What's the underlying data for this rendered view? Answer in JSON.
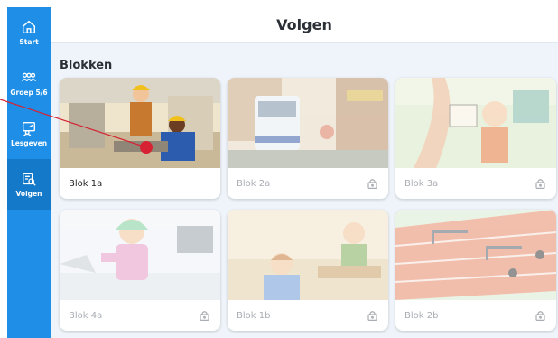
{
  "app": {
    "title": "Volgen"
  },
  "colors": {
    "sidebar": "#1e8ee6",
    "sidebar_active": "#1579c9",
    "background": "#eef4fa",
    "pointer": "#d62232"
  },
  "sidebar": {
    "items": [
      {
        "label": "Start",
        "icon": "home-icon"
      },
      {
        "label": "Groep 5/6",
        "icon": "group-icon"
      },
      {
        "label": "Lesgeven",
        "icon": "teach-icon"
      },
      {
        "label": "Volgen",
        "icon": "track-icon",
        "active": true
      }
    ]
  },
  "main": {
    "section_title": "Blokken",
    "cards": [
      {
        "label": "Blok 1a",
        "locked": false
      },
      {
        "label": "Blok 2a",
        "locked": true
      },
      {
        "label": "Blok 3a",
        "locked": true
      },
      {
        "label": "Blok 4a",
        "locked": true
      },
      {
        "label": "Blok 1b",
        "locked": true
      },
      {
        "label": "Blok 2b",
        "locked": true
      }
    ]
  }
}
